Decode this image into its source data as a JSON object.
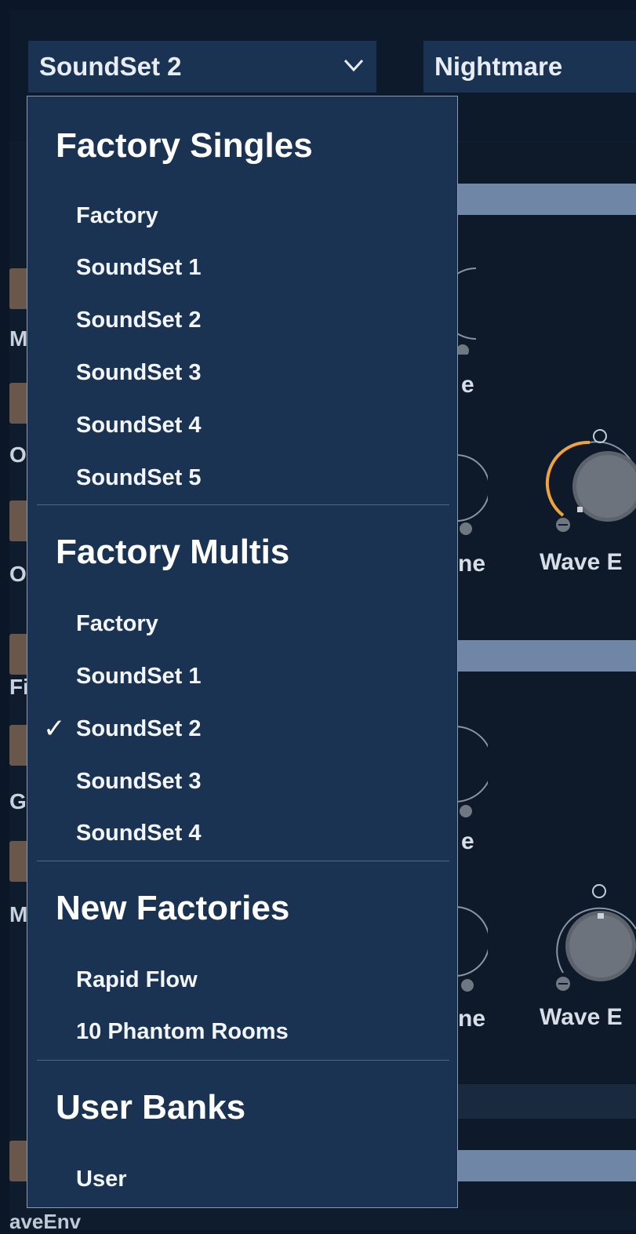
{
  "header": {
    "left_selector": "SoundSet 2",
    "right_selector": "Nightmare"
  },
  "background": {
    "left_labels": [
      "M",
      "O",
      "Os",
      "Fi",
      "Gl",
      "M"
    ],
    "bottom_label": "aveEnv",
    "knob_labels": {
      "partial_e_1": "e",
      "partial_ne_1": "ne",
      "wave_1": "Wave E",
      "partial_e_2": "e",
      "partial_ne_2": "ne",
      "wave_2": "Wave E"
    }
  },
  "dropdown": {
    "groups": [
      {
        "title": "Factory Singles",
        "items": [
          "Factory",
          "SoundSet 1",
          "SoundSet 2",
          "SoundSet 3",
          "SoundSet 4",
          "SoundSet 5"
        ]
      },
      {
        "title": "Factory Multis",
        "items": [
          "Factory",
          "SoundSet 1",
          "SoundSet 2",
          "SoundSet 3",
          "SoundSet 4"
        ]
      },
      {
        "title": "New Factories",
        "items": [
          "Rapid Flow",
          "10 Phantom Rooms"
        ]
      },
      {
        "title": "User Banks",
        "items": [
          "User"
        ]
      }
    ],
    "checkmark": "✓"
  },
  "colors": {
    "accent_orange": "#f0a33a",
    "menu_bg": "#1b3352",
    "section_bar": "#6f86a6"
  }
}
